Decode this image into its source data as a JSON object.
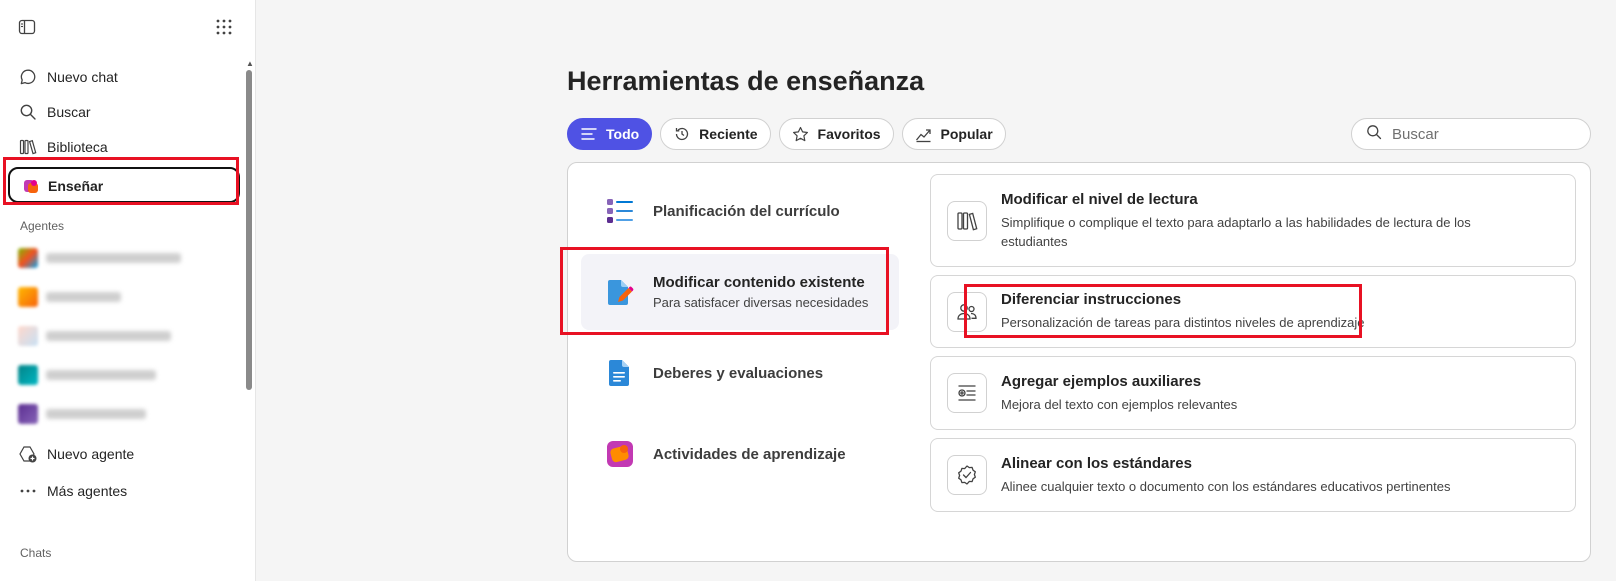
{
  "sidebar": {
    "nav": [
      {
        "label": "Nuevo chat",
        "icon": "chat-bubble-icon"
      },
      {
        "label": "Buscar",
        "icon": "search-icon"
      },
      {
        "label": "Biblioteca",
        "icon": "library-icon"
      }
    ],
    "active_item": {
      "label": "Enseñar",
      "icon": "teach-icon"
    },
    "agents_header": "Agentes",
    "agent_actions": [
      {
        "label": "Nuevo agente",
        "icon": "new-agent-icon"
      },
      {
        "label": "Más agentes",
        "icon": "more-icon"
      }
    ],
    "chats_header": "Chats"
  },
  "main": {
    "title": "Herramientas de enseñanza",
    "filters": [
      {
        "label": "Todo",
        "icon": "list-icon",
        "active": true
      },
      {
        "label": "Reciente",
        "icon": "history-icon"
      },
      {
        "label": "Favoritos",
        "icon": "star-icon"
      },
      {
        "label": "Popular",
        "icon": "trending-icon"
      }
    ],
    "search": {
      "placeholder": "Buscar"
    },
    "categories": [
      {
        "title": "Planificación del currículo",
        "subtitle": "",
        "icon": "curriculum-icon"
      },
      {
        "title": "Modificar contenido existente",
        "subtitle": "Para satisfacer diversas necesidades",
        "icon": "edit-document-icon",
        "selected": true
      },
      {
        "title": "Deberes y evaluaciones",
        "subtitle": "",
        "icon": "document-icon"
      },
      {
        "title": "Actividades de aprendizaje",
        "subtitle": "",
        "icon": "activities-icon"
      }
    ],
    "tools": [
      {
        "title": "Modificar el nivel de lectura",
        "description": "Simplifique o complique el texto para adaptarlo a las habilidades de lectura de los estudiantes",
        "icon": "books-icon"
      },
      {
        "title": "Diferenciar instrucciones",
        "description": "Personalización de tareas para distintos niveles de aprendizaje",
        "icon": "people-icon"
      },
      {
        "title": "Agregar ejemplos auxiliares",
        "description": "Mejora del texto con ejemplos relevantes",
        "icon": "text-add-icon"
      },
      {
        "title": "Alinear con los estándares",
        "description": "Alinee cualquier texto o documento con los estándares educativos pertinentes",
        "icon": "badge-check-icon"
      }
    ]
  },
  "colors": {
    "accent": "#4f52e4",
    "highlight": "#e81123"
  }
}
